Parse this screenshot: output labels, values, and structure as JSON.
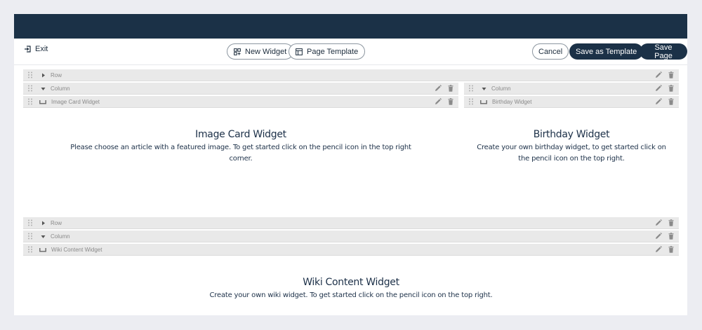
{
  "toolbar": {
    "exit_label": "Exit",
    "new_widget_label": "New Widget",
    "page_template_label": "Page Template",
    "cancel_label": "Cancel",
    "save_template_label": "Save as Template",
    "save_page_label": "Save Page"
  },
  "sections": [
    {
      "row_label": "Row",
      "columns": [
        {
          "column_label": "Column",
          "widget_label": "Image Card Widget",
          "title": "Image Card Widget",
          "description": "Please choose an article with a featured image. To get started click on the pencil icon in the top right corner."
        },
        {
          "column_label": "Column",
          "widget_label": "Birthday Widget",
          "title": "Birthday Widget",
          "description": "Create your own birthday widget, to get started click on the pencil icon on the top right."
        }
      ]
    },
    {
      "row_label": "Row",
      "columns": [
        {
          "column_label": "Column",
          "widget_label": "Wiki Content Widget",
          "title": "Wiki Content Widget",
          "description": "Create your own wiki widget. To get started click on the pencil icon on the top right."
        }
      ]
    }
  ],
  "icons": {
    "exit": "exit-icon",
    "new_widget": "grid-plus-icon",
    "page_template": "layout-template-icon",
    "drag": "drag-handle-icon",
    "expand": "caret-right-icon",
    "collapse": "caret-down-icon",
    "widget": "widget-bracket-icon",
    "edit": "pencil-icon",
    "delete": "trash-icon"
  },
  "colors": {
    "brand_dark": "#1b3147",
    "background": "#ecedf2",
    "bar_gray": "#e9e9e9"
  }
}
